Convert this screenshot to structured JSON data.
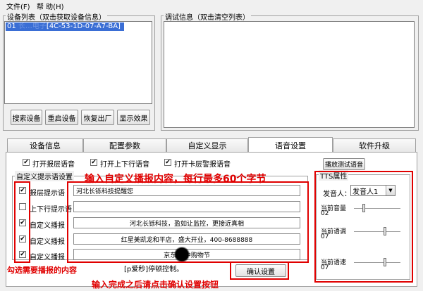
{
  "menu": {
    "file": "文件(F)",
    "help": "帮 助(H)"
  },
  "device_list": {
    "label": "设备列表（双击获取设备信息）",
    "row_number": "01",
    "row_occluded_text": "长…电子",
    "row_mac": "[4C-53-1D-07-A7-BA]"
  },
  "debug": {
    "label": "调试信息（双击清空列表）"
  },
  "buttons": {
    "search": "搜索设备",
    "restart": "重启设备",
    "restore": "恢复出厂",
    "show": "显示效果"
  },
  "tabs": [
    "设备信息",
    "配置参数",
    "自定义显示",
    "语音设置",
    "软件升级"
  ],
  "active_tab": 3,
  "top_checks": [
    {
      "label": "打开报层语音",
      "checked": true
    },
    {
      "label": "打开上下行语音",
      "checked": true
    },
    {
      "label": "打开卡层警报语音",
      "checked": true
    }
  ],
  "custom_group_label": "自定义提示语设置",
  "test_button": "播放测试语音",
  "rows": [
    {
      "checked": true,
      "label": "报层提示语",
      "value": "河北长铄科技提醒您",
      "align": "left"
    },
    {
      "checked": false,
      "label": "上下行提示语",
      "value": "",
      "align": "left"
    },
    {
      "checked": true,
      "label": "自定义播报",
      "value": "河北长铄科技，盈如让监控，更接近真相",
      "align": "center"
    },
    {
      "checked": true,
      "label": "自定义播报",
      "value": "红星美凯龙和平店，盛大开业，400-8688888",
      "align": "center"
    },
    {
      "checked": true,
      "label": "自定义播报",
      "value": "京东   年中购物节",
      "align": "center",
      "scribbled": true
    }
  ],
  "bracket_note": "[p爱秒]停顿控制。",
  "confirm_button": "确认设置",
  "tts": {
    "group_label": "TTS属性",
    "speaker_label": "发音人：",
    "speaker_value": "发音人1",
    "volume_label": "当前音量",
    "volume_value": "02",
    "volume_level": 0.2,
    "tone_label": "当前语调",
    "tone_value": "07",
    "tone_level": 0.7,
    "speed_label": "当前语速",
    "speed_value": "07",
    "speed_level": 0.7
  },
  "annotations": {
    "top": "输入自定义播报内容，每行最多60个字节",
    "left": "勾选需要播报的内容",
    "bottom": "输入完成之后请点击确认设置按钮"
  },
  "colors": {
    "annotation": "#e00000",
    "selection": "#3a6ed5"
  }
}
